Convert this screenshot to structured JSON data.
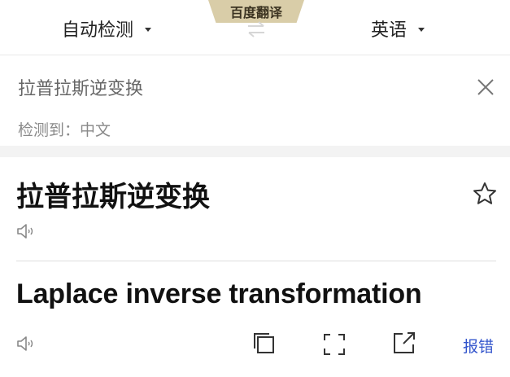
{
  "header": {
    "brand": "百度翻译",
    "source_lang": "自动检测",
    "target_lang": "英语"
  },
  "input": {
    "text": "拉普拉斯逆变换",
    "detected_label": "检测到：中文"
  },
  "source_display": {
    "text": "拉普拉斯逆变换"
  },
  "result": {
    "text": "Laplace inverse transformation",
    "report_label": "报错"
  },
  "colors": {
    "brand_bg": "#d9cda8",
    "link": "#3355cc"
  },
  "icons": [
    "swap-icon",
    "close-icon",
    "star-icon",
    "speaker-icon",
    "copy-icon",
    "fullscreen-icon",
    "share-icon"
  ]
}
